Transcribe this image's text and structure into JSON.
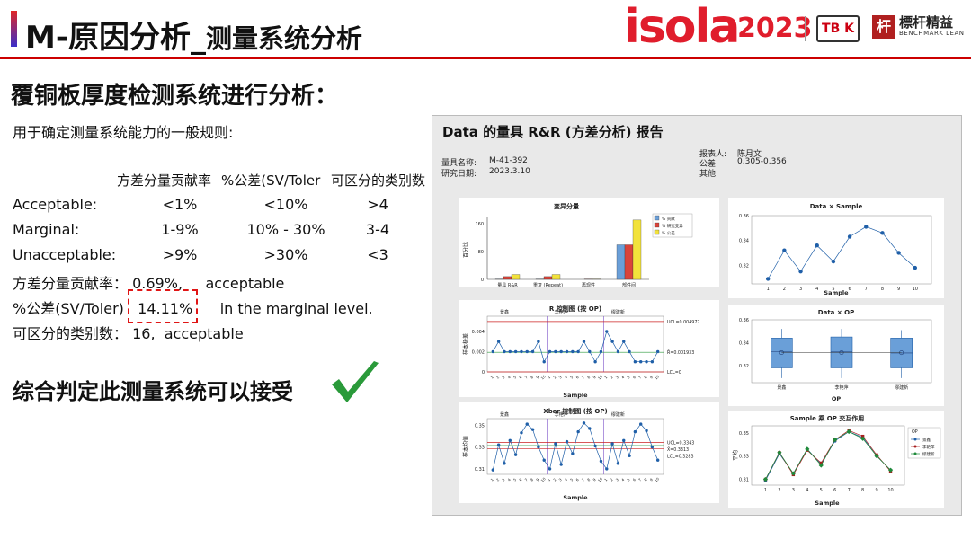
{
  "header": {
    "title_main": "M-原因分析_",
    "title_sub": "测量系统分析",
    "logo_isola": "isola",
    "logo_year": "2023",
    "logo_partner": "TB K",
    "logo_bm_mark": "杆",
    "logo_bm_cn": "標杆精益",
    "logo_bm_en": "BENCHMARK LEAN",
    "accent_color": "#e01d2c"
  },
  "heading": "覆铜板厚度检测系统进行分析：",
  "rules": {
    "intro": "用于确定测量系统能力的一般规则:",
    "columns": [
      "方差分量贡献率",
      "%公差(SV/Toler",
      "可区分的类别数"
    ],
    "rows": [
      {
        "label": "Acceptable:",
        "values": [
          "<1%",
          "<10%",
          ">4"
        ]
      },
      {
        "label": "Marginal:",
        "values": [
          "1-9%",
          "10% - 30%",
          "3-4"
        ]
      },
      {
        "label": "Unacceptable:",
        "values": [
          ">9%",
          ">30%",
          "<3"
        ]
      }
    ]
  },
  "results": {
    "r1_label": "方差分量贡献率：",
    "r1_value": "0.69%,",
    "r1_note": "acceptable",
    "r2_label": "%公差(SV/Toler)",
    "r2_value": "14.11%",
    "r2_note": "in the marginal level.",
    "r3_label": "可区分的类别数：",
    "r3_value": "16,",
    "r3_note": "acceptable"
  },
  "conclusion": "综合判定此测量系统可以接受",
  "report": {
    "title": "Data 的量具 R&R (方差分析) 报告",
    "gauge_name_label": "量具名称:",
    "gauge_name": "M-41-392",
    "study_date_label": "研究日期:",
    "study_date": "2023.3.10",
    "reporter_label": "报表人:",
    "reporter": "陈月文",
    "tolerance_label": "公差:",
    "tolerance": "0.305-0.356",
    "other_label": "其他:"
  },
  "chart_data": [
    {
      "type": "bar",
      "title": "变异分量",
      "ylabel": "百分比",
      "categories": [
        "量具 R&R",
        "重复 (Repeat)",
        "再现性",
        "部件间"
      ],
      "series": [
        {
          "name": "% 贡献",
          "color": "#6a9fd8",
          "values": [
            1,
            1,
            0,
            99
          ]
        },
        {
          "name": "% 研究变异",
          "color": "#d9433a",
          "values": [
            8,
            8,
            1,
            99
          ]
        },
        {
          "name": "% 公差",
          "color": "#f2e23b",
          "values": [
            14,
            14,
            1,
            170
          ]
        }
      ],
      "yticks": [
        0,
        80,
        160
      ],
      "ylim": [
        0,
        180
      ]
    },
    {
      "type": "line",
      "title": "R 控制图 (按 OP)",
      "ylabel": "样本极差",
      "xlabel": "Sample",
      "operators": [
        "景鑫",
        "李艳萍",
        "缪建新"
      ],
      "values": [
        0.002,
        0.003,
        0.002,
        0.002,
        0.002,
        0.002,
        0.002,
        0.002,
        0.003,
        0.001,
        0.002,
        0.002,
        0.002,
        0.002,
        0.002,
        0.002,
        0.003,
        0.002,
        0.001,
        0.002,
        0.004,
        0.003,
        0.002,
        0.003,
        0.002,
        0.001,
        0.001,
        0.001,
        0.001,
        0.002
      ],
      "ucl": 0.004977,
      "center": 0.001933,
      "lcl": 0,
      "ucl_label": "UCL=0.004977",
      "center_label": "R̄=0.001933",
      "lcl_label": "LCL=0",
      "yticks": [
        0.0,
        0.002,
        0.004
      ],
      "ylim": [
        0,
        0.0055
      ]
    },
    {
      "type": "line",
      "title": "Xbar 控制图 (按 OP)",
      "ylabel": "样本均值",
      "xlabel": "Sample",
      "operators": [
        "景鑫",
        "李艳萍",
        "缪建新"
      ],
      "values": [
        0.309,
        0.332,
        0.315,
        0.336,
        0.323,
        0.343,
        0.351,
        0.346,
        0.33,
        0.318,
        0.31,
        0.333,
        0.314,
        0.335,
        0.324,
        0.344,
        0.352,
        0.347,
        0.331,
        0.317,
        0.31,
        0.333,
        0.315,
        0.336,
        0.322,
        0.344,
        0.351,
        0.345,
        0.33,
        0.318
      ],
      "ucl": 0.3343,
      "center": 0.3313,
      "lcl": 0.3283,
      "ucl_label": "UCL=0.3343",
      "center_label": "X̄=0.3313",
      "lcl_label": "LCL=0.3283",
      "yticks": [
        0.31,
        0.33,
        0.35
      ],
      "ylim": [
        0.305,
        0.356
      ]
    },
    {
      "type": "line",
      "title": "Data × Sample",
      "xlabel": "Sample",
      "x": [
        1,
        2,
        3,
        4,
        5,
        6,
        7,
        8,
        9,
        10
      ],
      "values": [
        0.309,
        0.332,
        0.315,
        0.336,
        0.323,
        0.343,
        0.351,
        0.346,
        0.33,
        0.318
      ],
      "yticks": [
        0.32,
        0.34,
        0.36
      ],
      "ylim": [
        0.305,
        0.36
      ]
    },
    {
      "type": "box",
      "title": "Data × OP",
      "xlabel": "OP",
      "categories": [
        "景鑫",
        "李艳萍",
        "缪建新"
      ],
      "boxes": [
        {
          "min": 0.309,
          "q1": 0.318,
          "median": 0.332,
          "q3": 0.344,
          "max": 0.352,
          "mean": 0.3313
        },
        {
          "min": 0.309,
          "q1": 0.318,
          "median": 0.332,
          "q3": 0.345,
          "max": 0.352,
          "mean": 0.3313
        },
        {
          "min": 0.309,
          "q1": 0.318,
          "median": 0.331,
          "q3": 0.344,
          "max": 0.351,
          "mean": 0.3312
        }
      ],
      "yticks": [
        0.32,
        0.34,
        0.36
      ],
      "ylim": [
        0.305,
        0.36
      ]
    },
    {
      "type": "line",
      "title": "Sample 乘 OP 交互作用",
      "ylabel": "平均",
      "xlabel": "Sample",
      "legend_title": "OP",
      "x": [
        1,
        2,
        3,
        4,
        5,
        6,
        7,
        8,
        9,
        10
      ],
      "series": [
        {
          "name": "景鑫",
          "color": "#1f5fa8",
          "values": [
            0.309,
            0.332,
            0.315,
            0.336,
            0.323,
            0.343,
            0.351,
            0.346,
            0.33,
            0.318
          ]
        },
        {
          "name": "李艳萍",
          "color": "#a81f1f",
          "values": [
            0.31,
            0.333,
            0.314,
            0.335,
            0.324,
            0.344,
            0.352,
            0.347,
            0.331,
            0.317
          ]
        },
        {
          "name": "缪建新",
          "color": "#1f8a3a",
          "values": [
            0.31,
            0.333,
            0.315,
            0.336,
            0.322,
            0.344,
            0.351,
            0.345,
            0.33,
            0.318
          ]
        }
      ],
      "yticks": [
        0.31,
        0.33,
        0.35
      ],
      "ylim": [
        0.305,
        0.356
      ]
    }
  ]
}
